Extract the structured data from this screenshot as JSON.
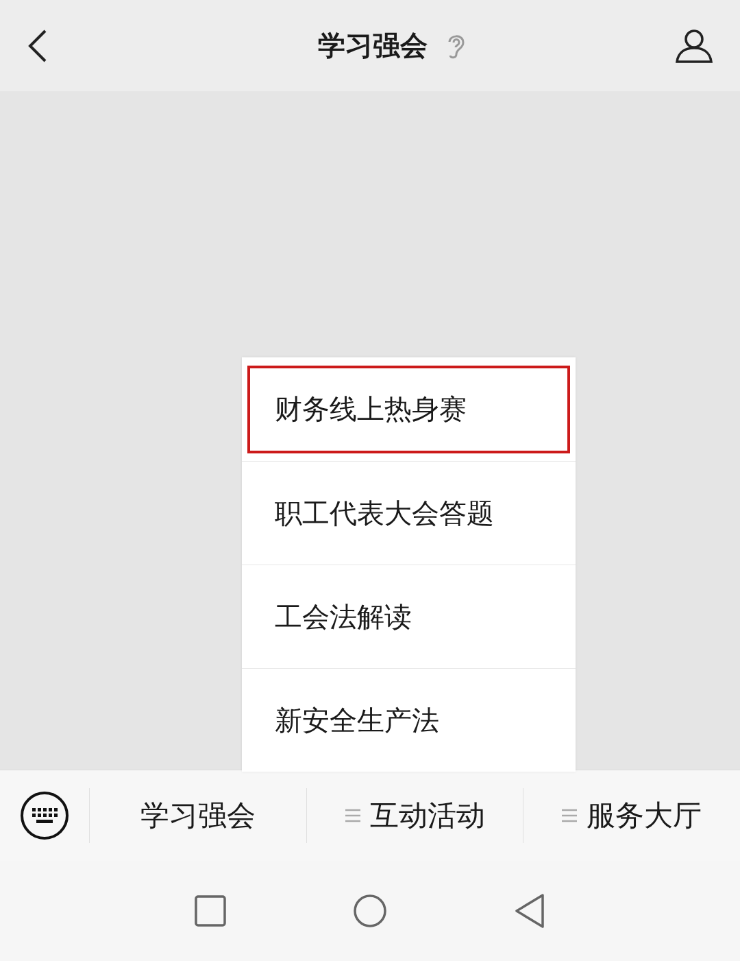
{
  "header": {
    "title": "学习强会"
  },
  "popup_menu": {
    "items": [
      {
        "label": "财务线上热身赛",
        "highlighted": true
      },
      {
        "label": "职工代表大会答题",
        "highlighted": false
      },
      {
        "label": "工会法解读",
        "highlighted": false
      },
      {
        "label": "新安全生产法",
        "highlighted": false
      }
    ]
  },
  "bottom_menu": {
    "items": [
      {
        "label": "学习强会",
        "has_submenu": false
      },
      {
        "label": "互动活动",
        "has_submenu": true
      },
      {
        "label": "服务大厅",
        "has_submenu": true
      }
    ]
  }
}
